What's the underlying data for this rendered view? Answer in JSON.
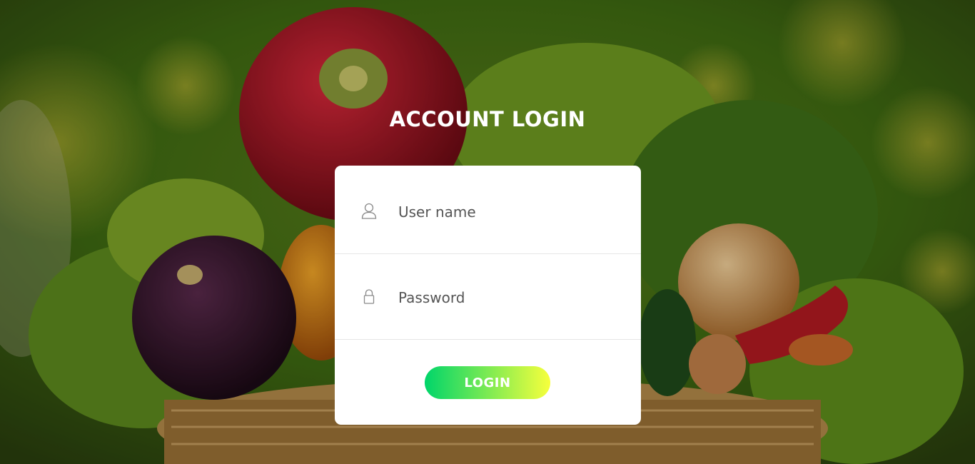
{
  "page": {
    "title": "ACCOUNT LOGIN"
  },
  "form": {
    "username_placeholder": "User name",
    "username_value": "",
    "password_placeholder": "Password",
    "password_value": "",
    "login_label": "LOGIN",
    "username_icon": "user-icon",
    "password_icon": "lock-icon"
  },
  "colors": {
    "button_gradient_start": "#00d56a",
    "button_gradient_end": "#f7ff3c",
    "card_background": "#ffffff",
    "title_color": "#ffffff"
  }
}
